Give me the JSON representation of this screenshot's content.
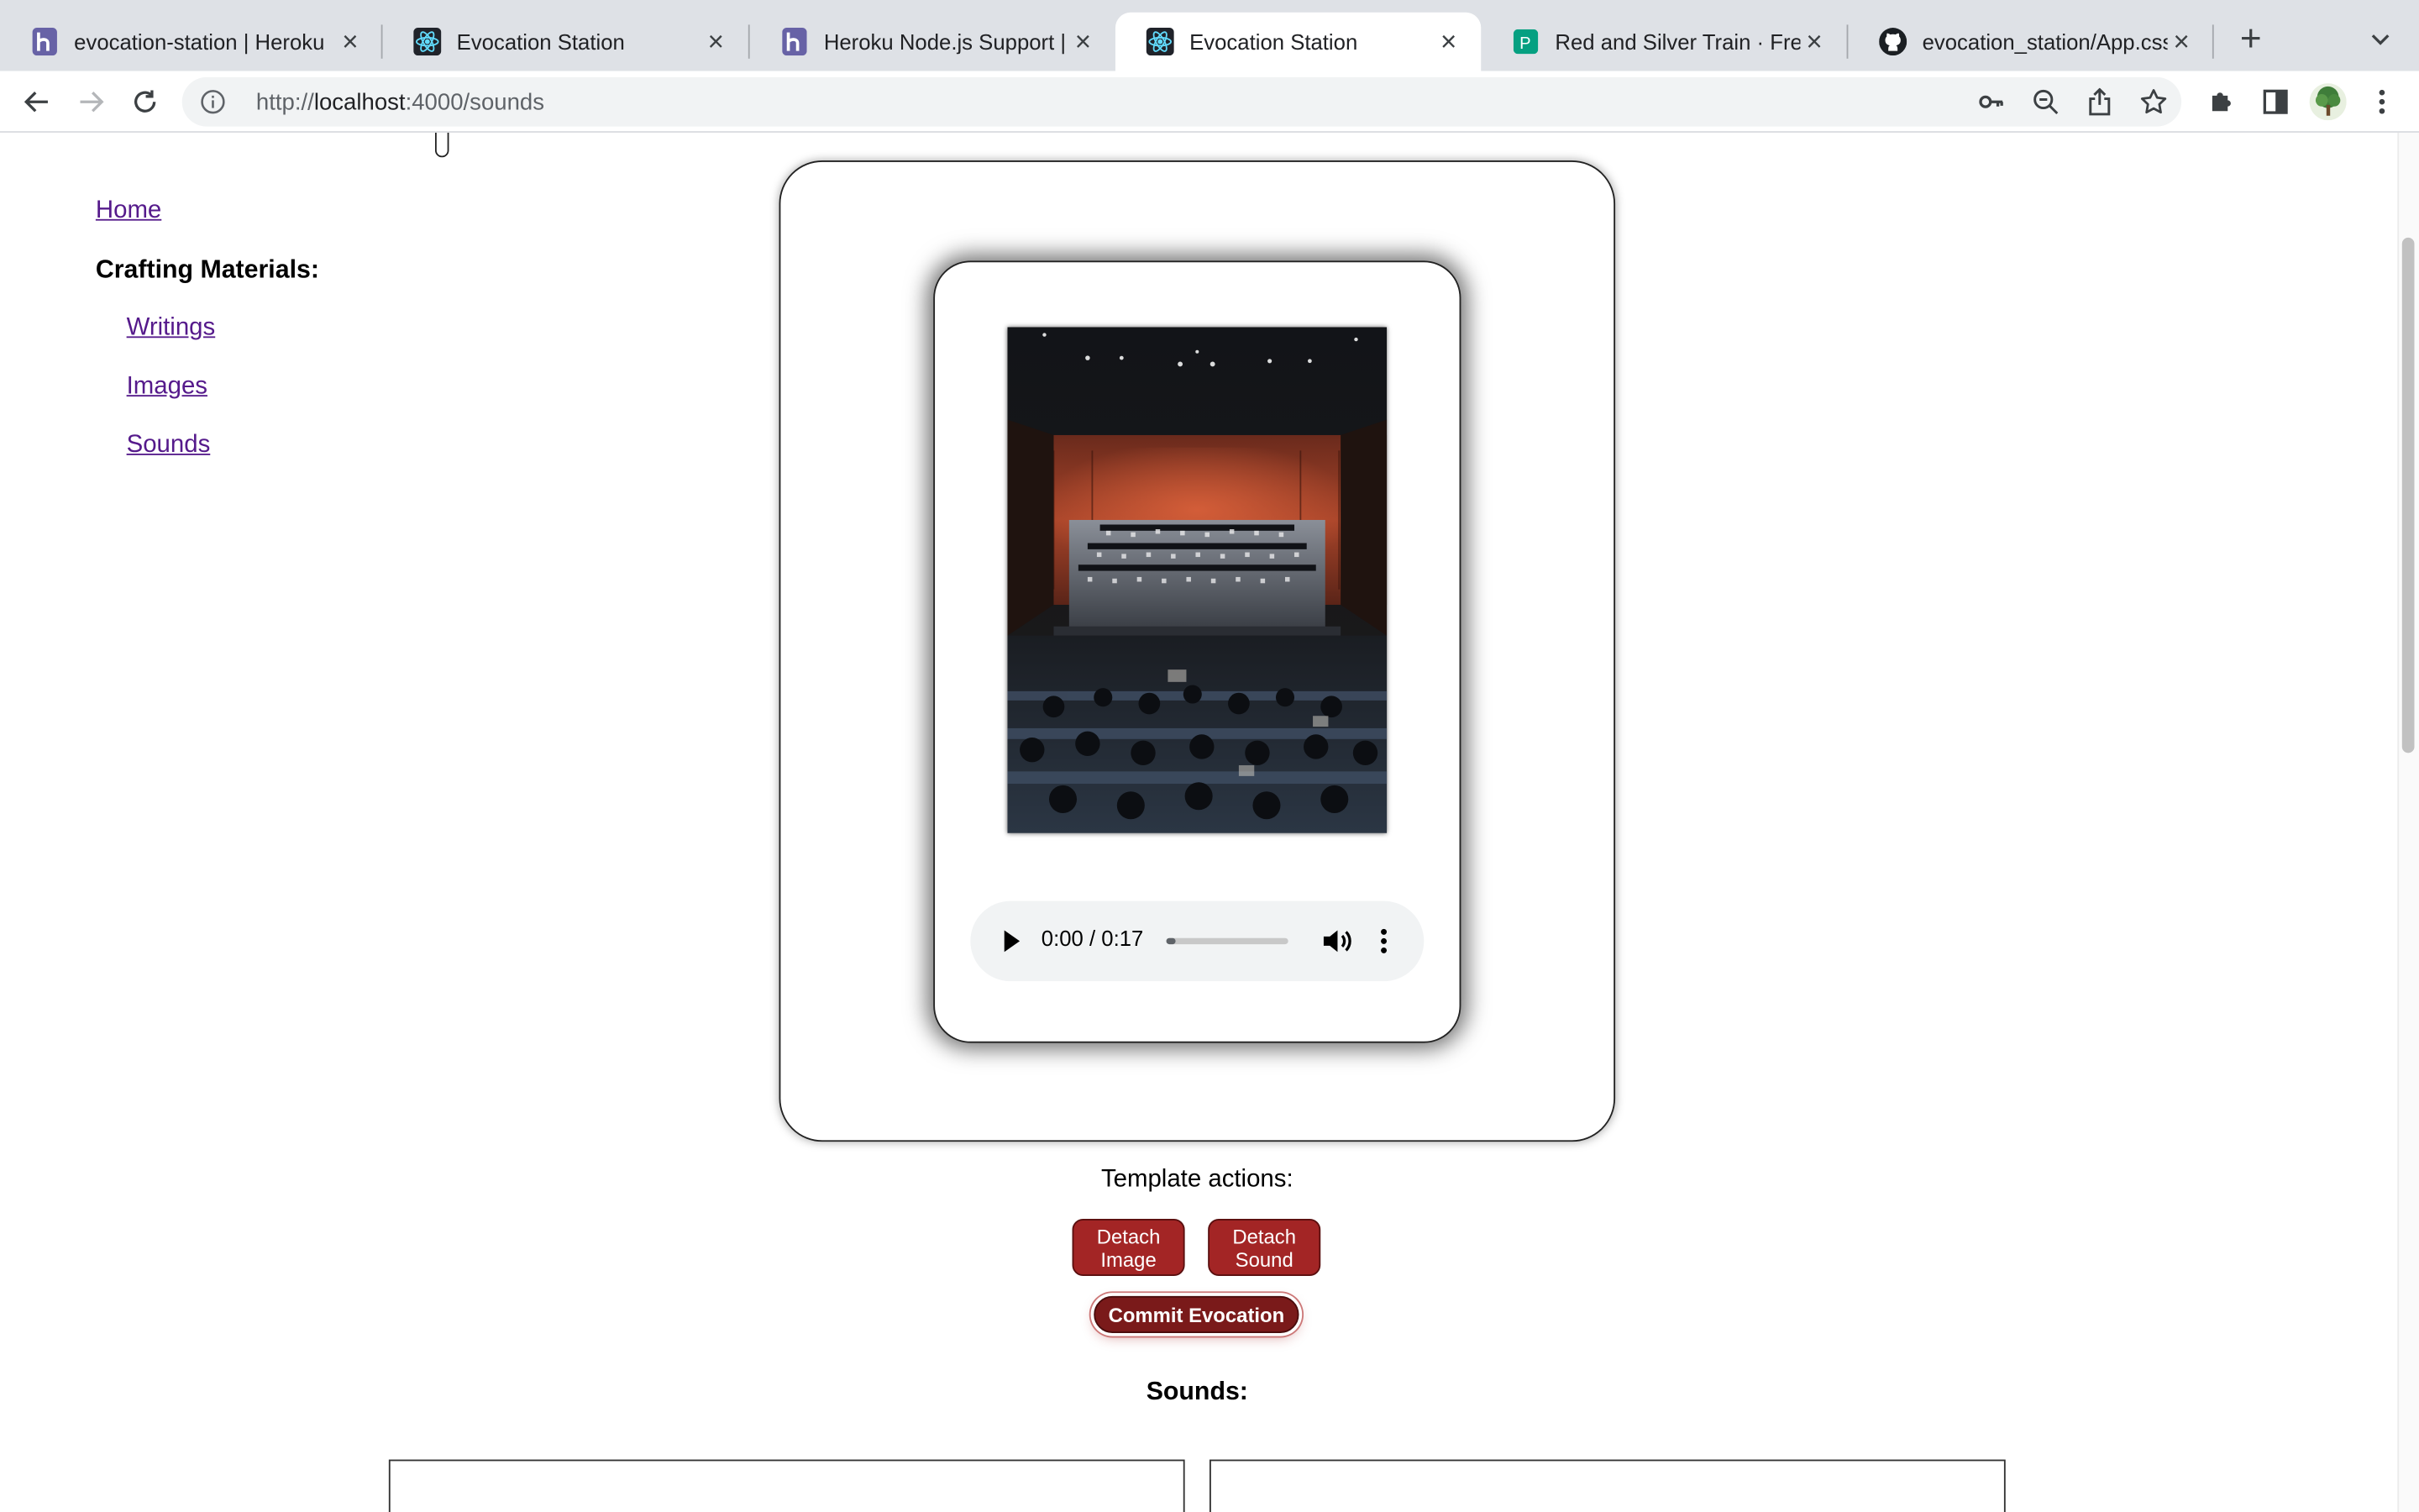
{
  "browser": {
    "tabs": [
      {
        "title": "evocation-station | Heroku",
        "favicon": "heroku-icon",
        "active": false
      },
      {
        "title": "Evocation Station",
        "favicon": "react-icon",
        "active": false
      },
      {
        "title": "Heroku Node.js Support | H",
        "favicon": "heroku-icon",
        "active": false
      },
      {
        "title": "Evocation Station",
        "favicon": "react-icon",
        "active": true
      },
      {
        "title": "Red and Silver Train · Free S",
        "favicon": "pexels-icon",
        "active": false
      },
      {
        "title": "evocation_station/App.css",
        "favicon": "github-icon",
        "active": false
      }
    ],
    "url_prefix": "http://",
    "url_host": "localhost",
    "url_path": ":4000/sounds",
    "colors": {
      "tabstrip": "#dee1e6",
      "omnibox": "#f1f3f4"
    }
  },
  "sidenav": {
    "home": "Home",
    "heading": "Crafting Materials:",
    "items": [
      "Writings",
      "Images",
      "Sounds"
    ]
  },
  "preview": {
    "image_alt": "concert-hall-orchestra-photo",
    "audio": {
      "time": "0:00 / 0:17",
      "progress_fraction": 0.0
    }
  },
  "template_actions": {
    "label": "Template actions:",
    "detach_image": "Detach Image",
    "detach_sound": "Detach Sound",
    "commit": "Commit Evocation",
    "colors": {
      "button": "#a32525",
      "commit": "#7a1a1a"
    }
  },
  "sounds_section": {
    "label": "Sounds:"
  }
}
